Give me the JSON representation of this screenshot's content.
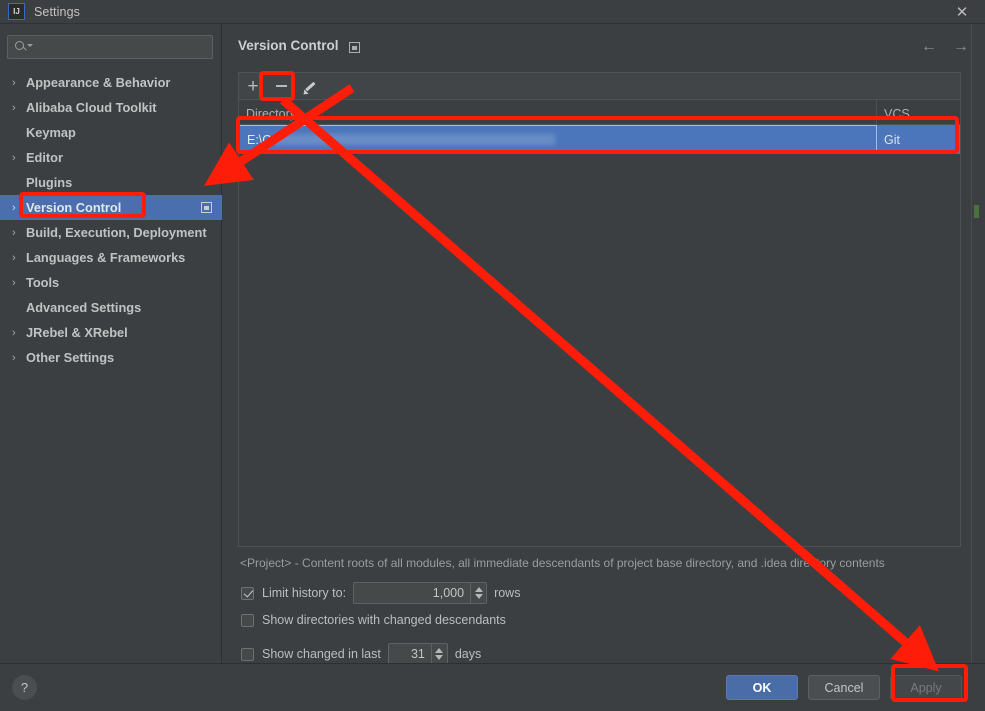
{
  "window": {
    "title": "Settings",
    "logo_text": "IJ",
    "logo_icon": "intellij-logo-icon",
    "close_icon": "close-icon"
  },
  "sidebar": {
    "search": {
      "placeholder": "",
      "value": "",
      "icon": "search-icon",
      "caret_icon": "chevron-down-icon"
    },
    "items": [
      {
        "label": "Appearance & Behavior",
        "expandable": true,
        "selected": false
      },
      {
        "label": "Alibaba Cloud Toolkit",
        "expandable": true,
        "selected": false
      },
      {
        "label": "Keymap",
        "expandable": false,
        "selected": false
      },
      {
        "label": "Editor",
        "expandable": true,
        "selected": false
      },
      {
        "label": "Plugins",
        "expandable": false,
        "selected": false
      },
      {
        "label": "Version Control",
        "expandable": true,
        "selected": true
      },
      {
        "label": "Build, Execution, Deployment",
        "expandable": true,
        "selected": false
      },
      {
        "label": "Languages & Frameworks",
        "expandable": true,
        "selected": false
      },
      {
        "label": "Tools",
        "expandable": true,
        "selected": false
      },
      {
        "label": "Advanced Settings",
        "expandable": false,
        "selected": false
      },
      {
        "label": "JRebel & XRebel",
        "expandable": true,
        "selected": false
      },
      {
        "label": "Other Settings",
        "expandable": true,
        "selected": false
      }
    ],
    "chevron_glyph": "›"
  },
  "pane": {
    "title": "Version Control",
    "badge_icon": "project-scope-icon",
    "nav_back_icon": "arrow-left-icon",
    "nav_forward_icon": "arrow-right-icon",
    "nav_back_glyph": "←",
    "nav_forward_glyph": "→"
  },
  "toolbar": {
    "add_label": "+",
    "add_icon": "plus-icon",
    "remove_icon": "minus-icon",
    "edit_icon": "pencil-icon"
  },
  "table": {
    "columns": [
      "Directory",
      "VCS"
    ],
    "rows": [
      {
        "directory": "E:\\C",
        "directory_redacted": true,
        "vcs": "Git",
        "selected": true
      }
    ],
    "description": "<Project> - Content roots of all modules, all immediate descendants of project base directory, and .idea directory contents"
  },
  "options": {
    "limit_history": {
      "label": "Limit history to:",
      "checked": true,
      "value": "1,000",
      "suffix": "rows"
    },
    "show_dirs_changed_descendants": {
      "label": "Show directories with changed descendants",
      "checked": false
    },
    "show_changed_in_last": {
      "label": "Show changed in last",
      "checked": false,
      "value": "31",
      "suffix": "days"
    }
  },
  "footer": {
    "help_label": "?",
    "help_icon": "help-icon",
    "ok_label": "OK",
    "cancel_label": "Cancel",
    "apply_label": "Apply"
  },
  "annotations": {
    "highlight_color": "#fd1d09",
    "boxes": [
      "remove-button",
      "selected-table-row",
      "sidebar-version-control",
      "apply-button"
    ],
    "arrows": [
      "toolbar-to-sidebar",
      "row-to-apply"
    ]
  },
  "colors": {
    "background": "#3c3f41",
    "selection_blue": "#4b6eaf",
    "row_blue": "#4b76bb",
    "ok_blue": "#4a6da7",
    "annotation_red": "#fd1d09"
  }
}
